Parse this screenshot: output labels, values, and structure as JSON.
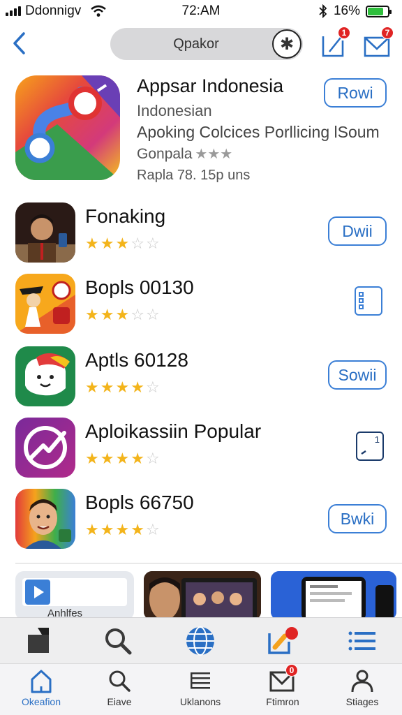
{
  "status_bar": {
    "carrier": "Ddonnigv",
    "time": "72:AM",
    "battery_percent": "16%",
    "battery_level": 0.16
  },
  "header": {
    "search_text": "Qpakor",
    "search_logo": "✱",
    "icons": [
      "back-icon",
      "share-icon",
      "mail-icon"
    ],
    "share_badge": "1",
    "mail_badge": "7"
  },
  "featured": {
    "title": "Appsar Indonesia",
    "subtitle": "Indonesian",
    "description": "Apoking Colcices Porllicing lSoum",
    "developer": "Gonpala",
    "rating": 3,
    "meta": "Rapla  78. 15p uns",
    "button": "Rowi"
  },
  "apps": [
    {
      "name": "Fonaking",
      "rating": 2.5,
      "button": "Dwii",
      "button_type": "pill"
    },
    {
      "name": "Bopls 00130",
      "rating": 2.5,
      "button": "",
      "button_type": "list-icon"
    },
    {
      "name": "Aptls 60128",
      "rating": 4,
      "button": "Sowii",
      "button_type": "pill"
    },
    {
      "name": "Aploikassiin Popular",
      "rating": 4,
      "button": "1",
      "button_type": "square"
    },
    {
      "name": "Bopls 66750",
      "rating": 4,
      "button": "Bwki",
      "button_type": "pill"
    }
  ],
  "cards": {
    "first_caption": "Anhlfes"
  },
  "tabbar_top": {
    "icons": [
      "bag-icon",
      "search-icon",
      "globe-icon",
      "edit-icon",
      "list-icon"
    ]
  },
  "tabbar_bottom": {
    "tabs": [
      {
        "label": "Okeafion",
        "icon": "home-icon",
        "active": true
      },
      {
        "label": "Eiave",
        "icon": "search-icon",
        "active": false
      },
      {
        "label": "Uklanons",
        "icon": "list-icon",
        "active": false
      },
      {
        "label": "Ftimron",
        "icon": "mail-icon",
        "active": false,
        "badge": "0"
      },
      {
        "label": "Stiages",
        "icon": "person-icon",
        "active": false
      }
    ]
  },
  "colors": {
    "accent": "#2a6fc4",
    "star": "#f3b41b",
    "badge": "#e02424"
  }
}
